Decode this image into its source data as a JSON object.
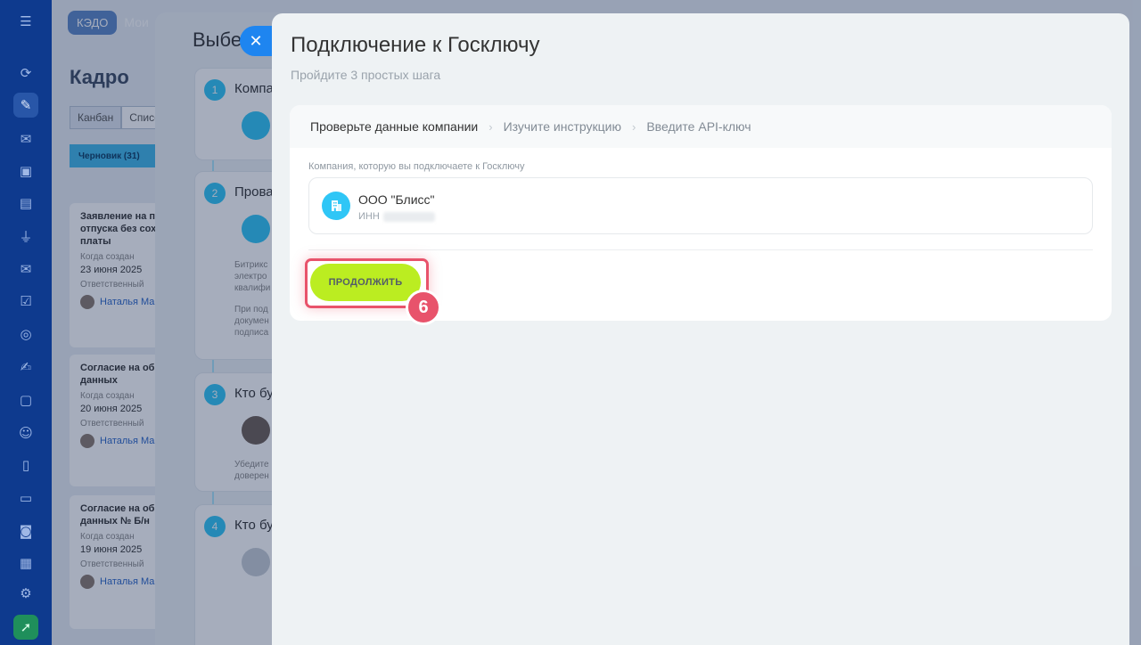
{
  "background_page": {
    "chip": "КЭДО",
    "top_text": "Мои",
    "title": "Кадро",
    "tabs": [
      "Канбан",
      "Списо"
    ],
    "column": "Черновик (31)",
    "cards": [
      {
        "title": "Заявление на пр отпуска без сох платы",
        "created_label": "Когда создан",
        "date": "23 июня 2025",
        "resp_label": "Ответственный",
        "person": "Наталья Ма"
      },
      {
        "title": "Согласие на обр данных",
        "created_label": "Когда создан",
        "date": "20 июня 2025",
        "resp_label": "Ответственный",
        "person": "Наталья Ма"
      },
      {
        "title": "Согласие на обр данных № Б/н",
        "created_label": "Когда создан",
        "date": "19 июня 2025",
        "resp_label": "Ответственный",
        "person": "Наталья Ма"
      }
    ]
  },
  "middle_slider": {
    "title": "Выбе",
    "steps": [
      {
        "num": "1",
        "name": "Компа"
      },
      {
        "num": "2",
        "name": "Прова",
        "text": [
          "Битрикс",
          "электро",
          "квалифи",
          "При под",
          "докумен",
          "подписа"
        ]
      },
      {
        "num": "3",
        "name": "Кто бу",
        "text": [
          "Убедите",
          "доверен"
        ]
      },
      {
        "num": "4",
        "name": "Кто бу"
      }
    ]
  },
  "slider": {
    "close_icon": "close-icon",
    "title": "Подключение к Госключу",
    "subtitle": "Пройдите 3 простых шага",
    "breadcrumbs": [
      "Проверьте данные компании",
      "Изучите инструкцию",
      "Введите API-ключ"
    ],
    "breadcrumb_sep": "›",
    "company_label": "Компания, которую вы подключаете к Госключу",
    "company_name": "ООО \"Блисс\"",
    "inn_label": "ИНН",
    "continue_label": "ПРОДОЛЖИТЬ",
    "step_badge": "6"
  },
  "colors": {
    "accent": "#2fc6f6",
    "button": "#bbed21",
    "highlight": "#e8536b"
  }
}
